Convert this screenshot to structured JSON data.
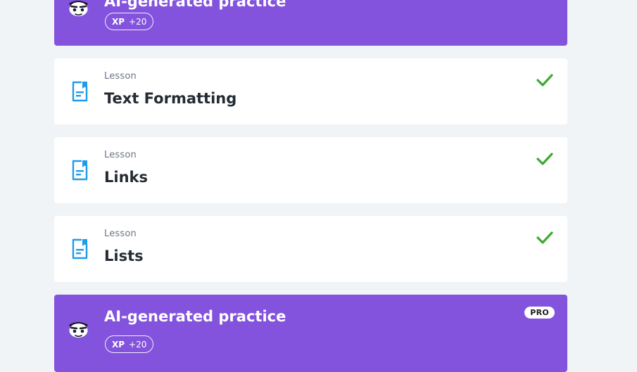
{
  "colors": {
    "background": "#f1f4f7",
    "practice_card": "#8353dd",
    "lesson_card": "#ffffff",
    "lesson_icon": "#1e9bea",
    "check": "#3caa2f"
  },
  "practice_top": {
    "title": "AI-generated practice",
    "xp_label": "XP",
    "xp_value": "+20",
    "icon": "mascot-icon"
  },
  "lessons": [
    {
      "kind": "Lesson",
      "title": "Text Formatting",
      "icon": "lesson-document-icon",
      "status": "completed",
      "status_icon": "checkmark-icon"
    },
    {
      "kind": "Lesson",
      "title": "Links",
      "icon": "lesson-document-icon",
      "status": "completed",
      "status_icon": "checkmark-icon"
    },
    {
      "kind": "Lesson",
      "title": "Lists",
      "icon": "lesson-document-icon",
      "status": "completed",
      "status_icon": "checkmark-icon"
    }
  ],
  "practice_bottom": {
    "title": "AI-generated practice",
    "pro_label": "PRO",
    "xp_label": "XP",
    "xp_value": "+20",
    "icon": "mascot-icon"
  }
}
